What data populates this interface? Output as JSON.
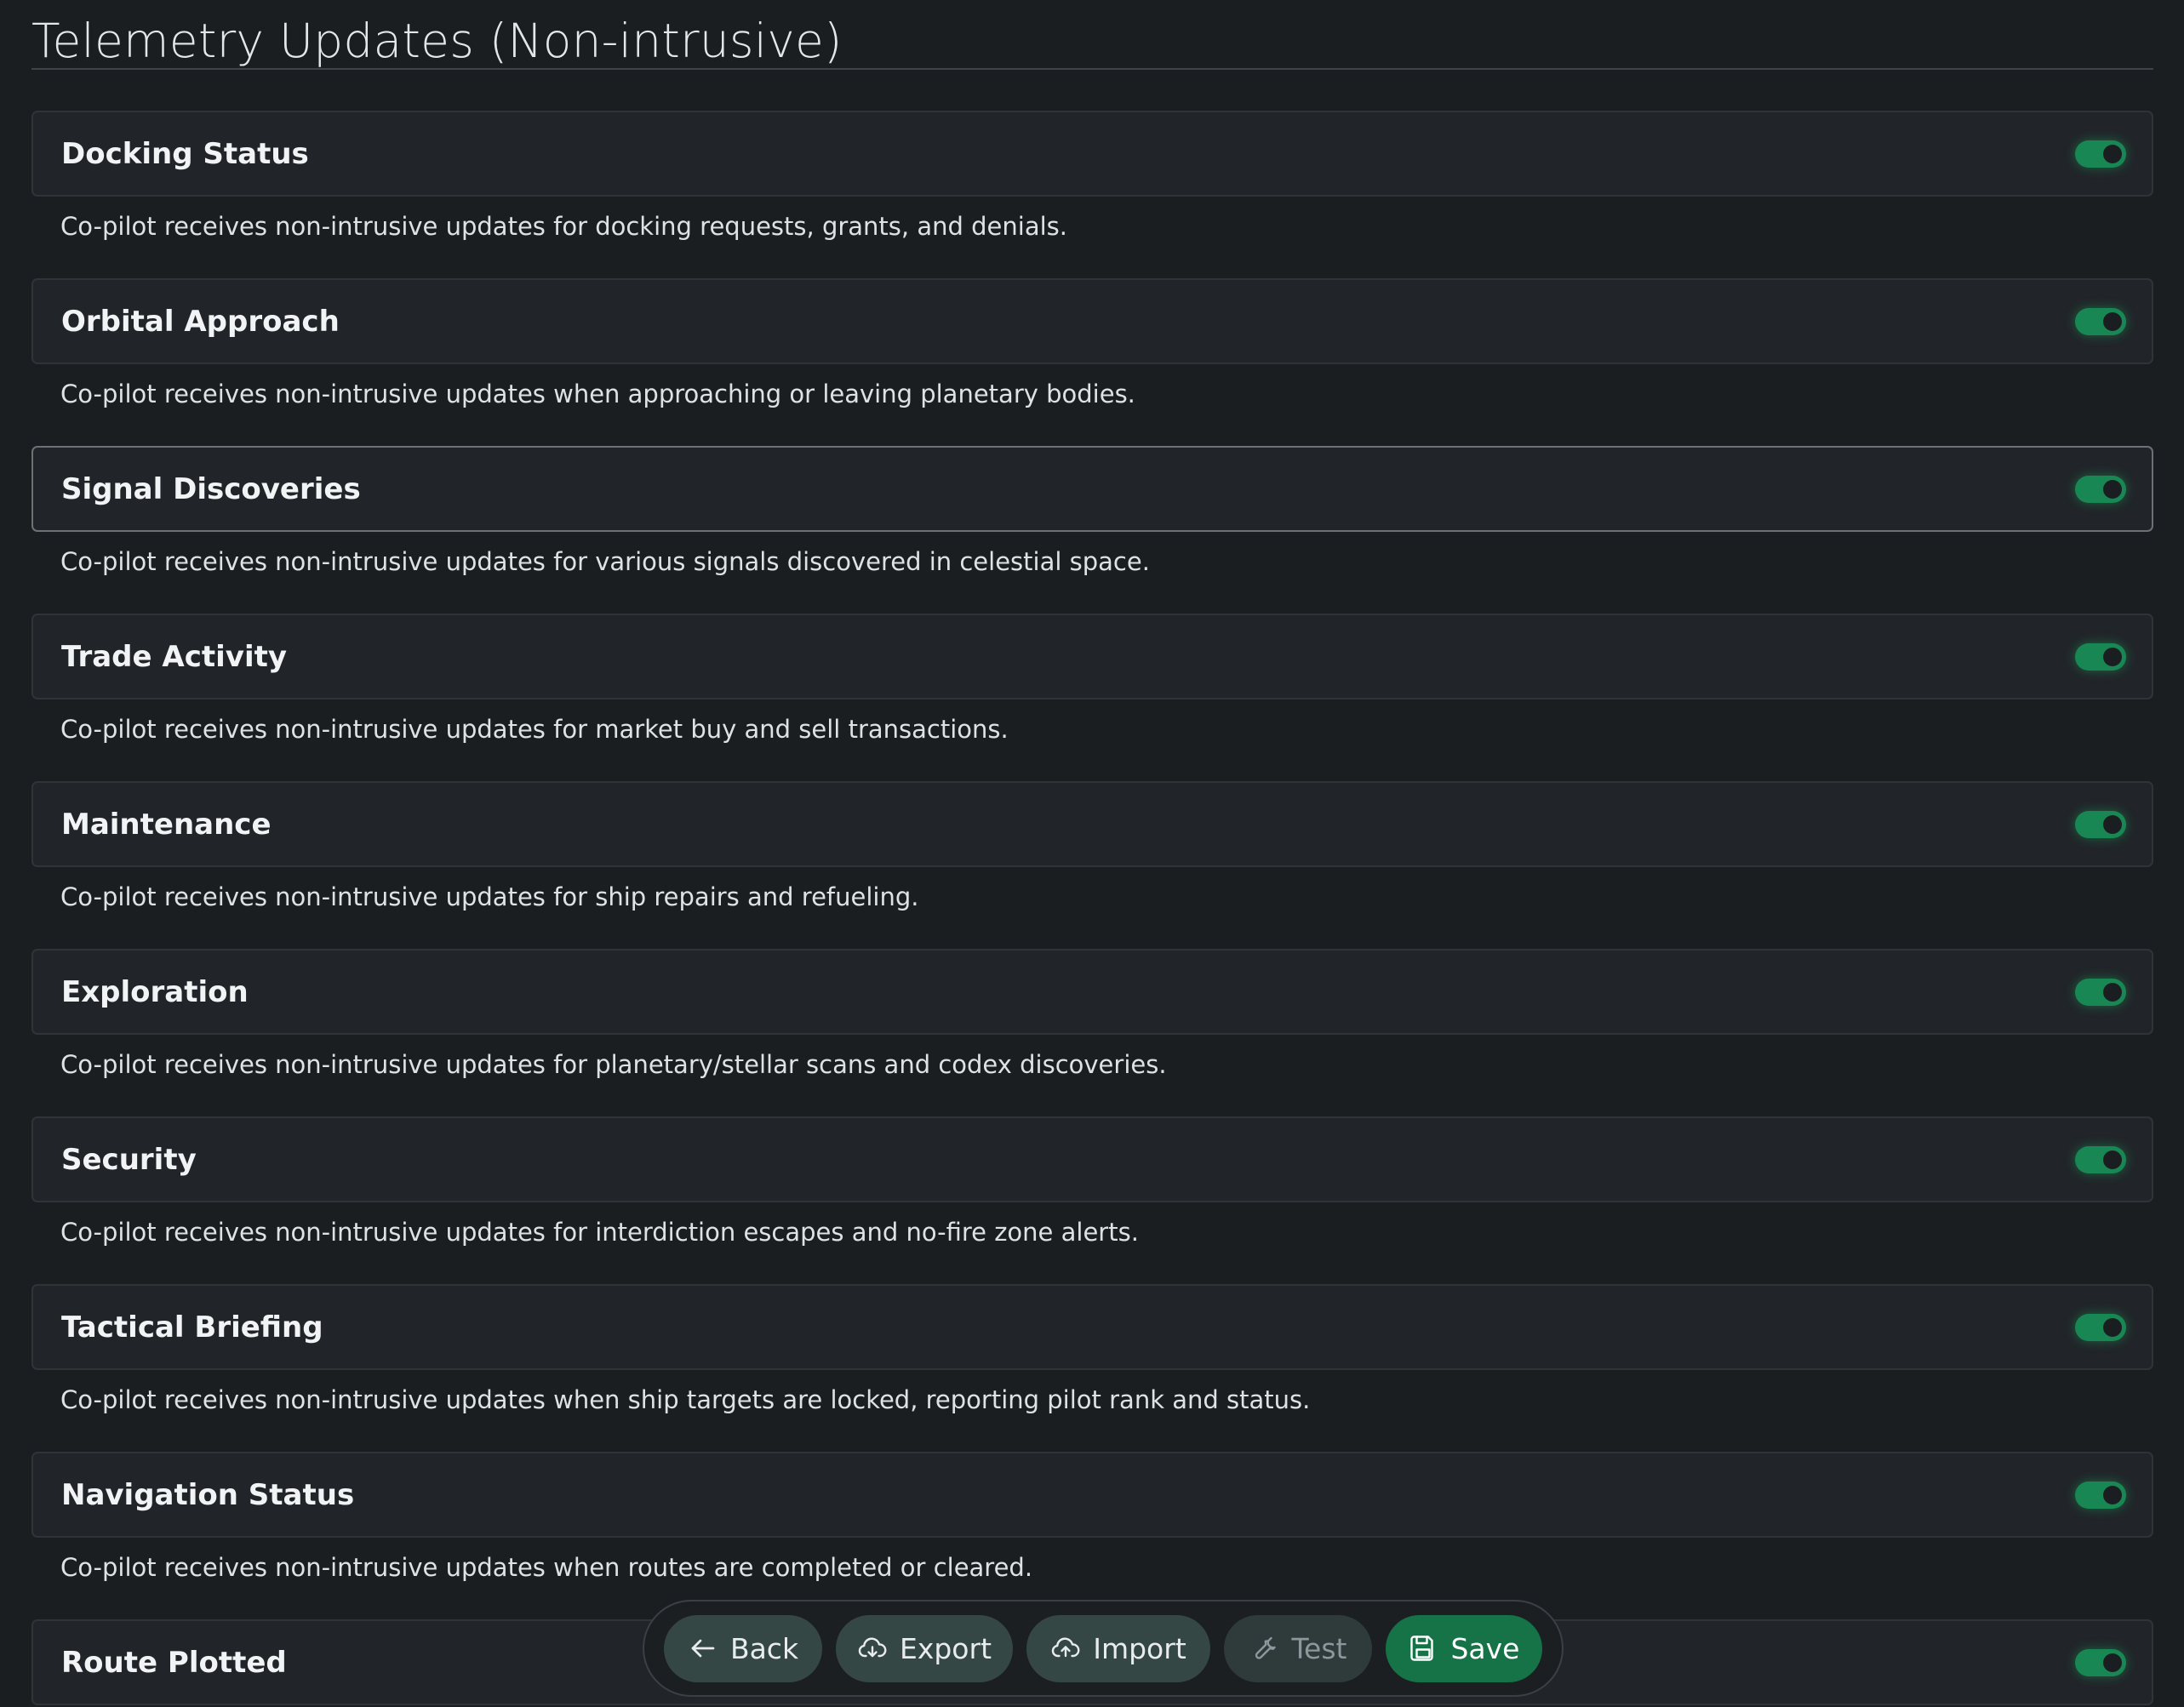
{
  "page_title": "Telemetry Updates (Non-intrusive)",
  "settings": [
    {
      "label": "Docking Status",
      "enabled": true,
      "description": "Co-pilot receives non-intrusive updates for docking requests, grants, and denials."
    },
    {
      "label": "Orbital Approach",
      "enabled": true,
      "description": "Co-pilot receives non-intrusive updates when approaching or leaving planetary bodies."
    },
    {
      "label": "Signal Discoveries",
      "enabled": true,
      "description": "Co-pilot receives non-intrusive updates for various signals discovered in celestial space."
    },
    {
      "label": "Trade Activity",
      "enabled": true,
      "description": "Co-pilot receives non-intrusive updates for market buy and sell transactions."
    },
    {
      "label": "Maintenance",
      "enabled": true,
      "description": "Co-pilot receives non-intrusive updates for ship repairs and refueling."
    },
    {
      "label": "Exploration",
      "enabled": true,
      "description": "Co-pilot receives non-intrusive updates for planetary/stellar scans and codex discoveries."
    },
    {
      "label": "Security",
      "enabled": true,
      "description": "Co-pilot receives non-intrusive updates for interdiction escapes and no-fire zone alerts."
    },
    {
      "label": "Tactical Briefing",
      "enabled": true,
      "description": "Co-pilot receives non-intrusive updates when ship targets are locked, reporting pilot rank and status."
    },
    {
      "label": "Navigation Status",
      "enabled": true,
      "description": "Co-pilot receives non-intrusive updates when routes are completed or cleared."
    },
    {
      "label": "Route Plotted",
      "enabled": true,
      "description": ""
    }
  ],
  "action_bar": {
    "back": {
      "label": "Back",
      "icon": "arrow-left-icon"
    },
    "export": {
      "label": "Export",
      "icon": "cloud-download-icon"
    },
    "import": {
      "label": "Import",
      "icon": "cloud-upload-icon"
    },
    "test": {
      "label": "Test",
      "icon": "wrench-icon"
    },
    "save": {
      "label": "Save",
      "icon": "floppy-disk-icon"
    }
  },
  "colors": {
    "background": "#1b1e21",
    "card": "#212529",
    "toggle_on": "#198754",
    "save_button": "#157347",
    "secondary_button": "#344745"
  }
}
